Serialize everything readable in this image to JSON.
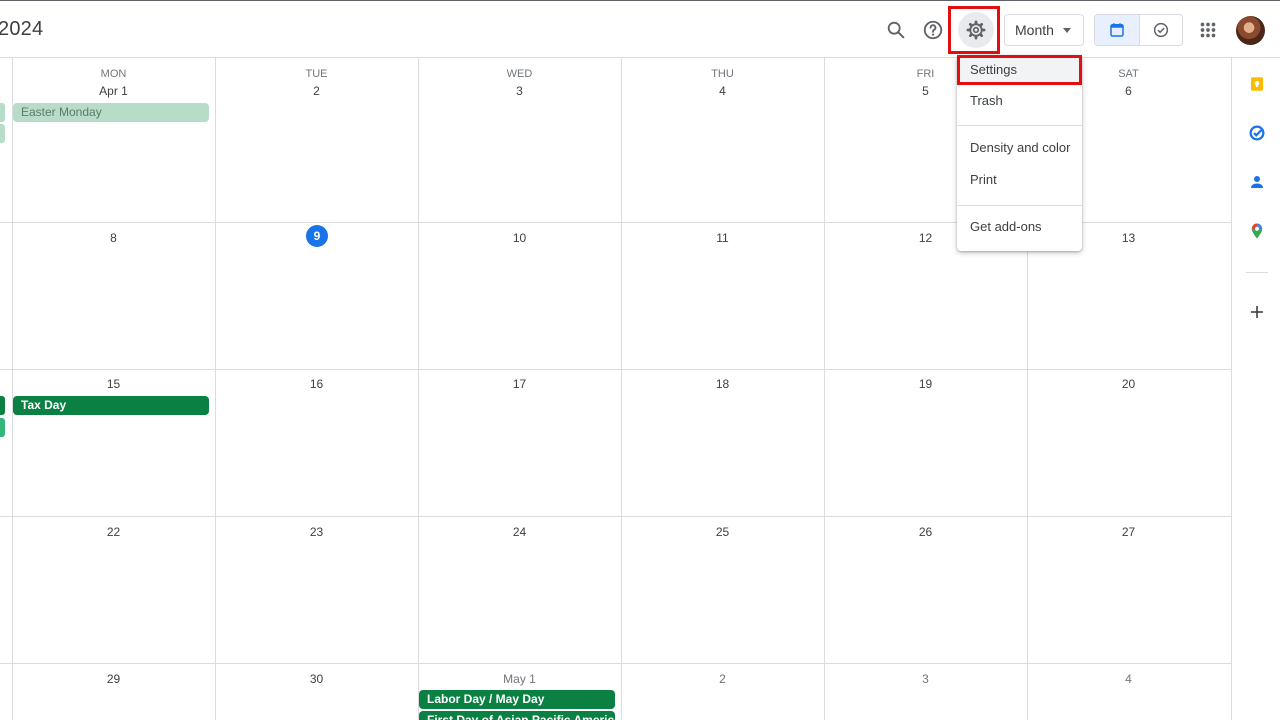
{
  "header": {
    "title": "2024",
    "view_label": "Month",
    "icons": [
      "search-icon",
      "help-icon",
      "gear-icon",
      "calendar-icon",
      "tasks-check-icon",
      "apps-grid-icon"
    ]
  },
  "weekdays": [
    "MON",
    "TUE",
    "WED",
    "THU",
    "FRI",
    "SAT"
  ],
  "weeks": [
    [
      "Apr 1",
      "2",
      "3",
      "4",
      "5",
      "6"
    ],
    [
      "8",
      "9",
      "10",
      "11",
      "12",
      "13"
    ],
    [
      "15",
      "16",
      "17",
      "18",
      "19",
      "20"
    ],
    [
      "22",
      "23",
      "24",
      "25",
      "26",
      "27"
    ],
    [
      "29",
      "30",
      "May 1",
      "2",
      "3",
      "4"
    ]
  ],
  "today": "9",
  "events": {
    "easter_monday": "Easter Monday",
    "tax_day": "Tax Day",
    "labor_day": "Labor Day / May Day",
    "asian_pacific": "First Day of Asian Pacific American H"
  },
  "menu": {
    "settings": "Settings",
    "trash": "Trash",
    "density": "Density and color",
    "print": "Print",
    "addons": "Get add-ons"
  },
  "colors": {
    "accent": "#1a73e8",
    "holiday_green": "#0b8043",
    "holiday_pale": "#b7dcc8",
    "highlight": "#e01010"
  }
}
